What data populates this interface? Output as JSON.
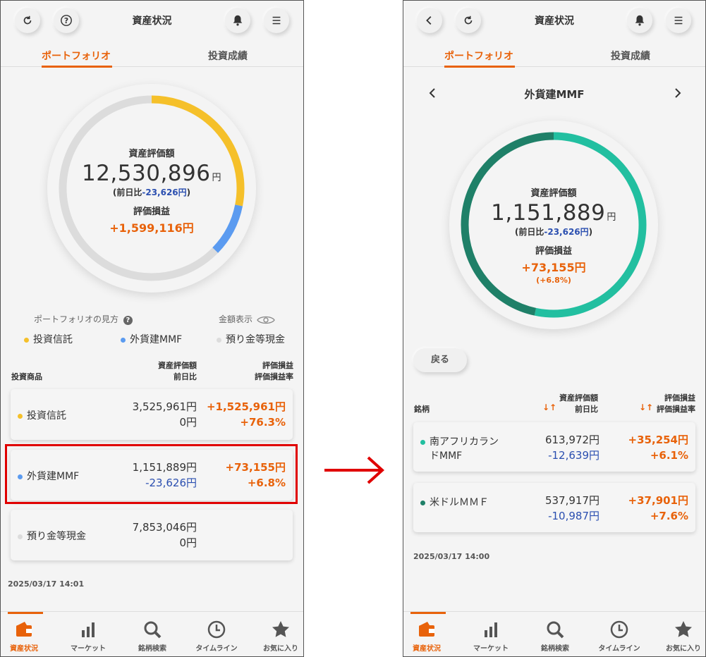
{
  "left": {
    "title": "資産状況",
    "tabs": [
      "ポートフォリオ",
      "投資成績"
    ],
    "donut": {
      "label": "資産評価額",
      "amount": "12,530,896",
      "yen": "円",
      "diff_prefix": "(前日比",
      "diff": "-23,626円",
      "diff_suffix": ")",
      "pl_label": "評価損益",
      "pl": "+1,599,116円",
      "segments": [
        {
          "name": "投資信託",
          "fraction": 0.281,
          "color": "#f5c02a"
        },
        {
          "name": "外貨建MMF",
          "fraction": 0.092,
          "color": "#5b9bf0"
        },
        {
          "name": "預り金等現金",
          "fraction": 0.627,
          "color": "#dcdcdc"
        }
      ]
    },
    "view_help": "ポートフォリオの見方",
    "amount_display": "金額表示",
    "legend": [
      "投資信託",
      "外貨建MMF",
      "預り金等現金"
    ],
    "legend_colors": [
      "#f5c02a",
      "#5b9bf0",
      "#dcdcdc"
    ],
    "headers": {
      "product": "投資商品",
      "value1": "資産評価額",
      "value2": "前日比",
      "pl1": "評価損益",
      "pl2": "評価損益率"
    },
    "rows": [
      {
        "name": "投資信託",
        "color": "#f5c02a",
        "value": "3,525,961円",
        "diff": "0円",
        "pl": "+1,525,961円",
        "rate": "+76.3%"
      },
      {
        "name": "外貨建MMF",
        "color": "#5b9bf0",
        "value": "1,151,889円",
        "diff": "-23,626円",
        "pl": "+73,155円",
        "rate": "+6.8%"
      },
      {
        "name": "預り金等現金",
        "color": "#dcdcdc",
        "value": "7,853,046円",
        "diff": "0円",
        "pl": "",
        "rate": ""
      }
    ],
    "timestamp": "2025/03/17 14:01"
  },
  "right": {
    "title": "資産状況",
    "tabs": [
      "ポートフォリオ",
      "投資成績"
    ],
    "subtitle": "外貨建MMF",
    "donut": {
      "label": "資産評価額",
      "amount": "1,151,889",
      "yen": "円",
      "diff_prefix": "(前日比",
      "diff": "-23,626円",
      "diff_suffix": ")",
      "pl_label": "評価損益",
      "pl": "+73,155円",
      "pl_rate": "(+6.8%)",
      "segments": [
        {
          "name": "南アフリカランドMMF",
          "fraction": 0.533,
          "color": "#22bfa0"
        },
        {
          "name": "米ドルＭＭＦ",
          "fraction": 0.467,
          "color": "#1f8068"
        }
      ]
    },
    "back": "戻る",
    "headers": {
      "product": "銘柄",
      "value1": "資産評価額",
      "value2": "前日比",
      "pl1": "評価損益",
      "pl2": "評価損益率"
    },
    "rows": [
      {
        "name1": "南アフリカラン",
        "name2": "ドMMF",
        "color": "#22bfa0",
        "value": "613,972円",
        "diff": "-12,639円",
        "pl": "+35,254円",
        "rate": "+6.1%"
      },
      {
        "name1": "米ドルＭＭＦ",
        "name2": "",
        "color": "#1f8068",
        "value": "537,917円",
        "diff": "-10,987円",
        "pl": "+37,901円",
        "rate": "+7.6%"
      }
    ],
    "timestamp": "2025/03/17 14:00"
  },
  "nav": [
    "資産状況",
    "マーケット",
    "銘柄検索",
    "タイムライン",
    "お気に入り"
  ],
  "colors": {
    "accent": "#e8620a",
    "negative": "#2b4fb0",
    "highlight": "#e00000"
  }
}
